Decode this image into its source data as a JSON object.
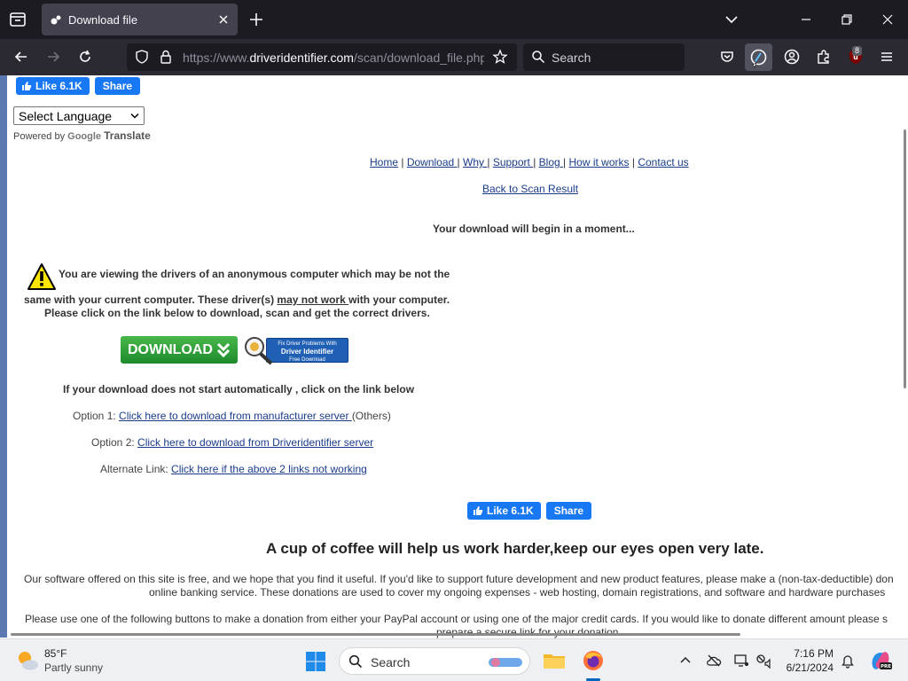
{
  "browser": {
    "tab_title": "Download file",
    "url_prefix": "https://www.",
    "url_domain": "driveridentifier.com",
    "url_path": "/scan/download_file.php",
    "search_placeholder": "Search",
    "extension_badge": "8",
    "accent_color": "#1c1b22"
  },
  "page": {
    "fb_top": {
      "like": "Like 6.1K",
      "share": "Share"
    },
    "language_select": "Select Language",
    "powered_by": "Powered by",
    "google": "Google",
    "translate": "Translate",
    "nav": {
      "home": "Home",
      "download": "Download ",
      "why": "Why ",
      "support": "Support ",
      "blog": "Blog ",
      "how": "How it works",
      "contact": "Contact us",
      "sep": "|"
    },
    "back_link": "Back to Scan Result",
    "begin_msg": "Your download will begin in a moment...",
    "warning": {
      "line1": "You are viewing the drivers of an anonymous computer which may be not the",
      "line2_before": "same with your current computer. These driver(s) ",
      "line2_link": "may not work ",
      "line2_after": "with your computer.",
      "line3": "Please click on the link below to download, scan and get the correct drivers."
    },
    "download_button": "DOWNLOAD",
    "di_badge": {
      "small_top": "Fix Driver Problems With",
      "name": "Driver Identifier",
      "small_bottom": "Free Download"
    },
    "dl_info": "If your download does not start automatically , click on the link below",
    "option1": {
      "label": "Option 1: ",
      "link": "Click here to download from manufacturer server ",
      "suffix": "(Others)"
    },
    "option2": {
      "label": "Option 2: ",
      "link": "Click here to download from Driveridentifier server"
    },
    "alternate": {
      "label": "Alternate Link: ",
      "link": "Click here if the above 2 links not working"
    },
    "fb_mid": {
      "like": "Like 6.1K",
      "share": "Share"
    },
    "coffee_heading": "A cup of coffee will help us work harder,keep our eyes open very late.",
    "para1_line1": "Our software offered on this site is free, and we hope that you find it useful. If you'd like to support future development and new product features, please make a (non-tax-deductible) don",
    "para1_line2": "online banking service. These donations are used to cover my ongoing expenses - web hosting, domain registrations, and software and hardware purchases",
    "para2_line1": "Please use one of the following buttons to make a donation from either your PayPal account or using one of the major credit cards. If you would like to donate different amount please s",
    "para2_line2": "prepare a secure link for your donation."
  },
  "taskbar": {
    "temperature": "85°F",
    "condition": "Partly sunny",
    "search": "Search",
    "time": "7:16 PM",
    "date": "6/21/2024"
  }
}
